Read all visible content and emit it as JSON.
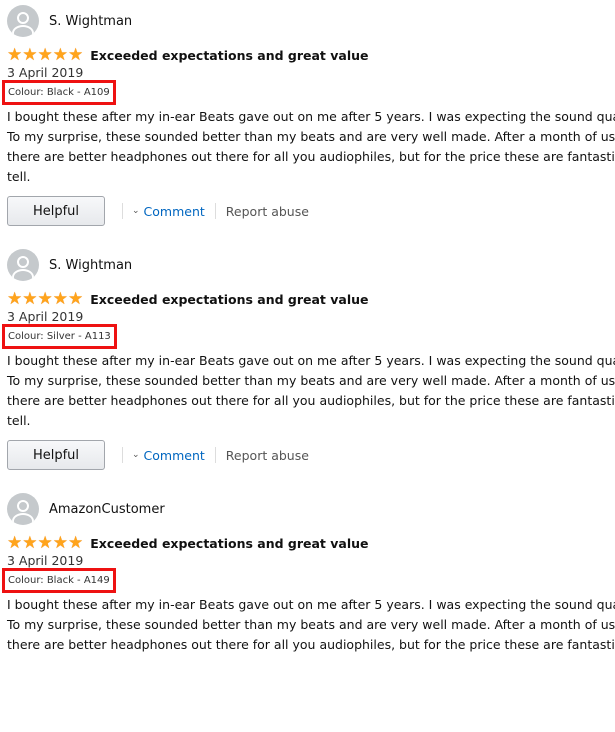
{
  "reviews": [
    {
      "profile_name": "S. Wightman",
      "rating": 5,
      "title": "Exceeded expectations and great value",
      "date": "3 April 2019",
      "colour": "Colour: Black - A109",
      "body_lines": [
        "I bought these after my in-ear Beats gave out on me after 5 years. I was expecting the sound quality to",
        "To my surprise, these sounded better than my beats and are very well made. After a month of use I hav",
        "there are better headphones out there for all you audiophiles, but for the price these are fantastic. I do",
        "tell."
      ],
      "helpful_label": "Helpful",
      "comment_label": "Comment",
      "report_label": "Report abuse"
    },
    {
      "profile_name": "S. Wightman",
      "rating": 5,
      "title": "Exceeded expectations and great value",
      "date": "3 April 2019",
      "colour": "Colour: Silver - A113",
      "body_lines": [
        "I bought these after my in-ear Beats gave out on me after 5 years. I was expecting the sound quality to",
        "To my surprise, these sounded better than my beats and are very well made. After a month of use I hav",
        "there are better headphones out there for all you audiophiles, but for the price these are fantastic. I do",
        "tell."
      ],
      "helpful_label": "Helpful",
      "comment_label": "Comment",
      "report_label": "Report abuse"
    },
    {
      "profile_name": "AmazonCustomer",
      "rating": 5,
      "title": "Exceeded expectations and great value",
      "date": "3 April 2019",
      "colour": "Colour: Black - A149",
      "body_lines": [
        "I bought these after my in-ear Beats gave out on me after 5 years. I was expecting the sound quality to",
        "To my surprise, these sounded better than my beats and are very well made. After a month of use I hav",
        "there are better headphones out there for all you audiophiles, but for the price these are fantastic. I do"
      ]
    }
  ],
  "icons": {
    "avatar": "user-avatar-icon",
    "star": "star-icon",
    "chevron": "chevron-down-icon"
  },
  "colors": {
    "star": "#ffa41c",
    "highlight_box": "#ee1111",
    "link": "#0066c0"
  }
}
